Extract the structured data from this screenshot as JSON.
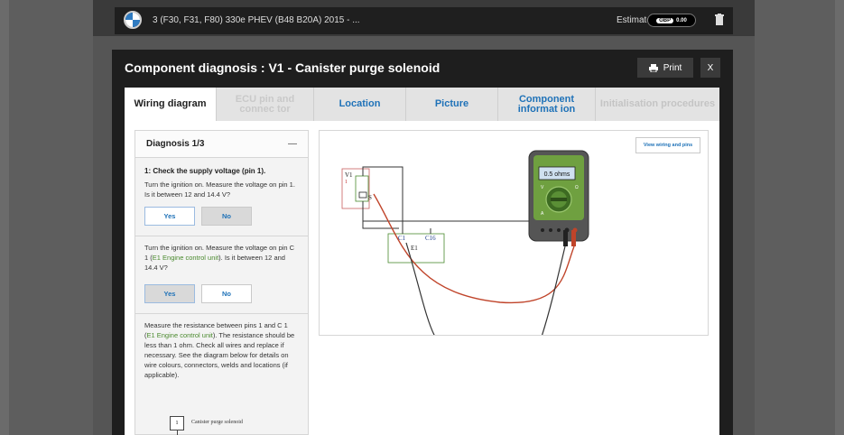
{
  "topbar": {
    "vehicle_title": "3 (F30, F31, F80) 330e PHEV (B48 B20A) 2015 - ...",
    "estimate_label": "Estimate",
    "estimate_currency": "GBP",
    "estimate_value": "0.00"
  },
  "modal": {
    "title": "Component diagnosis : V1 - Canister purge solenoid",
    "print_label": "Print",
    "close_label": "X"
  },
  "tabs": [
    {
      "label": "Wiring diagram"
    },
    {
      "label": "ECU pin and connec tor"
    },
    {
      "label": "Location"
    },
    {
      "label": "Picture"
    },
    {
      "label": "Component informat ion"
    },
    {
      "label": "Initialisation procedures"
    }
  ],
  "diagnosis": {
    "header": "Diagnosis 1/3",
    "collapse_symbol": "—",
    "step_title": "1: Check the supply voltage (pin 1).",
    "q1": "Turn the ignition on. Measure the voltage on pin 1. Is it between 12 and 14.4 V?",
    "q2_pre": "Turn the ignition on. Measure the voltage on pin C 1 (",
    "q2_link": "E1 Engine control unit",
    "q2_post": "). Is it between 12 and 14.4 V?",
    "q3_pre": "Measure the resistance between pins 1 and C 1 (",
    "q3_link": "E1 Engine control unit",
    "q3_post": "). The resistance should be less than 1 ohm. Check all wires and replace if necessary. See the diagram below for details on wire colours, connectors, welds and locations (if applicable).",
    "yes_label": "Yes",
    "no_label": "No",
    "mini_pin": "1",
    "mini_label": "Canister purge solenoid"
  },
  "wiring": {
    "view_button": "View wiring and pins",
    "meter_reading": "0.5 ohms",
    "label_v1": "V1",
    "label_v1_pin": "1",
    "label_s": "S",
    "label_c1": "C1",
    "label_c16": "C16",
    "label_e1": "E1",
    "meter_v": "V",
    "meter_omega": "Ω",
    "meter_a": "A"
  }
}
